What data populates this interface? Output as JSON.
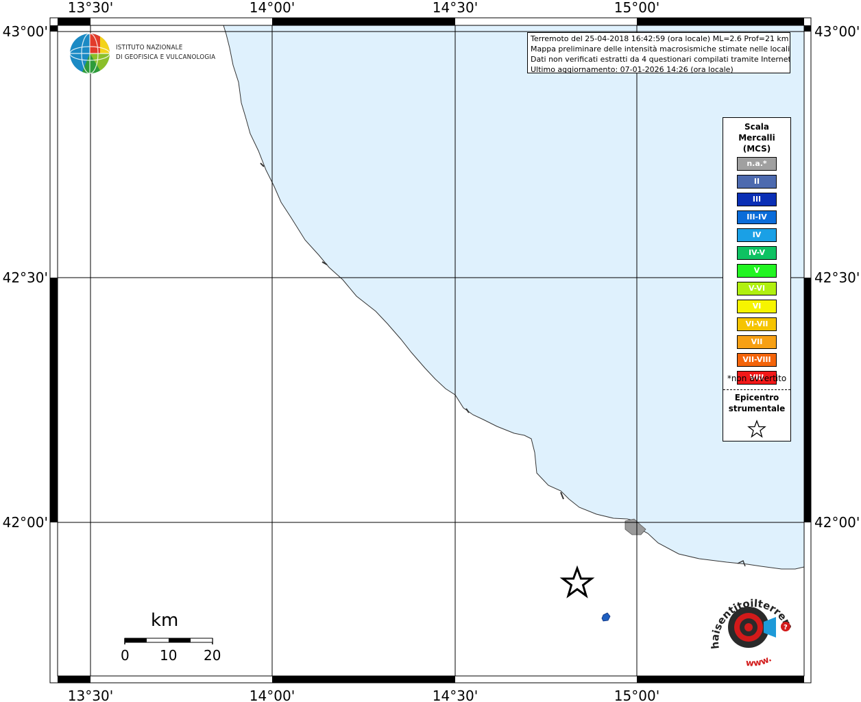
{
  "map": {
    "lon_labels": [
      "13°30'",
      "14°00'",
      "14°30'",
      "15°00'"
    ],
    "lat_labels": [
      "43°00'",
      "42°30'",
      "42°00'"
    ],
    "sea_color": "#dff1fd",
    "land_color": "#ffffff",
    "epicenter_marker": "star-icon",
    "felt_report_color": "#1f5fbf"
  },
  "info": {
    "line1": "Terremoto del 25-04-2018 16:42:59 (ora locale) ML=2.6 Prof=21 km",
    "line2": "Mappa preliminare delle intensità macrosismiche stimate nelle località",
    "line3": "Dati non verificati estratti da 4 questionari compilati tramite Internet.",
    "line4": "Ultimo aggiornamento: 07-01-2026 14:26 (ora locale)"
  },
  "legend": {
    "title_line1": "Scala",
    "title_line2": "Mercalli",
    "title_line3": "(MCS)",
    "items": [
      {
        "label": "n.a.*",
        "color": "#a0a0a0"
      },
      {
        "label": "II",
        "color": "#4d6aaf"
      },
      {
        "label": "III",
        "color": "#0a2fb5"
      },
      {
        "label": "III-IV",
        "color": "#0a6cd9"
      },
      {
        "label": "IV",
        "color": "#1aa0e6"
      },
      {
        "label": "IV-V",
        "color": "#0ec262"
      },
      {
        "label": "V",
        "color": "#22f422"
      },
      {
        "label": "V-VI",
        "color": "#b0f010"
      },
      {
        "label": "VI",
        "color": "#f6f400"
      },
      {
        "label": "VI-VII",
        "color": "#f5c400"
      },
      {
        "label": "VII",
        "color": "#f7a014"
      },
      {
        "label": "VII-VIII",
        "color": "#f4640a"
      },
      {
        "label": "VIII",
        "color": "#f21818"
      }
    ],
    "note": "*non avvertito",
    "epicenter_line1": "Epicentro",
    "epicenter_line2": "strumentale"
  },
  "logos": {
    "ingv_line1": "ISTITUTO NAZIONALE",
    "ingv_line2": "DI GEOFISICA E VULCANOLOGIA",
    "hsit_text": "haisentitoilterremoto.it",
    "hsit_url": "www."
  },
  "scale_bar": {
    "unit": "km",
    "ticks": [
      "0",
      "10",
      "20"
    ]
  }
}
